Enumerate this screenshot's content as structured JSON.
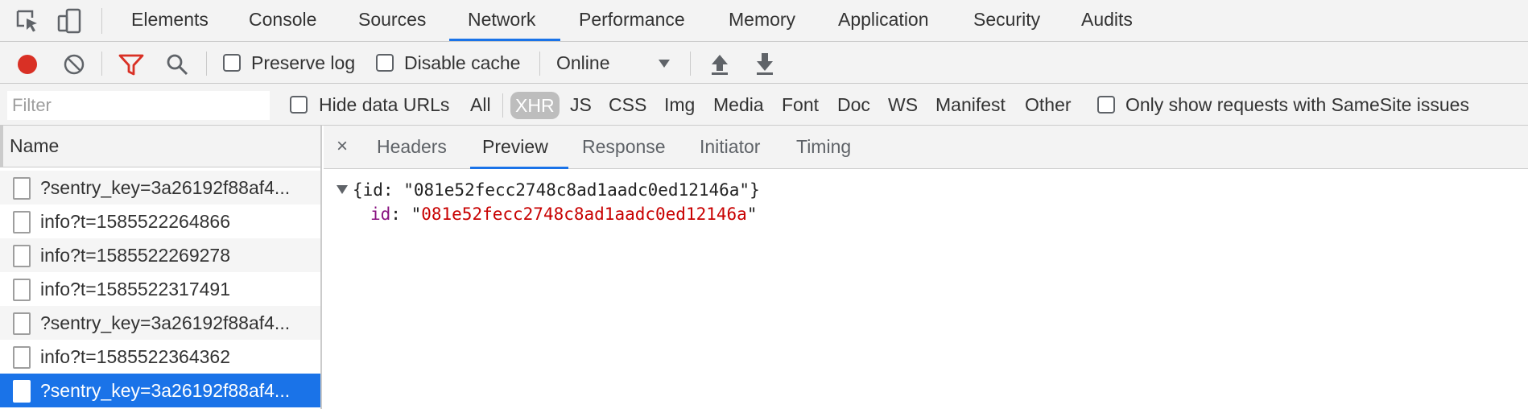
{
  "top_tabs": [
    {
      "label": "Elements"
    },
    {
      "label": "Console"
    },
    {
      "label": "Sources"
    },
    {
      "label": "Network",
      "active": true
    },
    {
      "label": "Performance"
    },
    {
      "label": "Memory"
    },
    {
      "label": "Application"
    },
    {
      "label": "Security"
    },
    {
      "label": "Audits"
    }
  ],
  "toolbar": {
    "preserve_log": "Preserve log",
    "disable_cache": "Disable cache",
    "throttling": "Online"
  },
  "filter": {
    "placeholder": "Filter",
    "hide_data_urls": "Hide data URLs",
    "types": [
      {
        "label": "All"
      },
      {
        "label": "XHR",
        "active": true
      },
      {
        "label": "JS"
      },
      {
        "label": "CSS"
      },
      {
        "label": "Img"
      },
      {
        "label": "Media"
      },
      {
        "label": "Font"
      },
      {
        "label": "Doc"
      },
      {
        "label": "WS"
      },
      {
        "label": "Manifest"
      },
      {
        "label": "Other"
      }
    ],
    "samesite": "Only show requests with SameSite issues"
  },
  "requests": {
    "header": "Name",
    "rows": [
      {
        "name": "?sentry_key=3a26192f88af4..."
      },
      {
        "name": "info?t=1585522264866"
      },
      {
        "name": "info?t=1585522269278"
      },
      {
        "name": "info?t=1585522317491"
      },
      {
        "name": "?sentry_key=3a26192f88af4..."
      },
      {
        "name": "info?t=1585522364362"
      },
      {
        "name": "?sentry_key=3a26192f88af4...",
        "selected": true
      }
    ]
  },
  "detail": {
    "close": "×",
    "tabs": [
      {
        "label": "Headers"
      },
      {
        "label": "Preview",
        "active": true
      },
      {
        "label": "Response"
      },
      {
        "label": "Initiator"
      },
      {
        "label": "Timing"
      }
    ],
    "preview": {
      "summary": "{id: \"081e52fecc2748c8ad1aadc0ed12146a\"}",
      "key": "id",
      "value": "081e52fecc2748c8ad1aadc0ed12146a"
    }
  },
  "colors": {
    "accent": "#1a73e8",
    "record": "#d93025",
    "filter_icon": "#d93025",
    "json_key": "#881280",
    "json_string": "#c80000"
  }
}
